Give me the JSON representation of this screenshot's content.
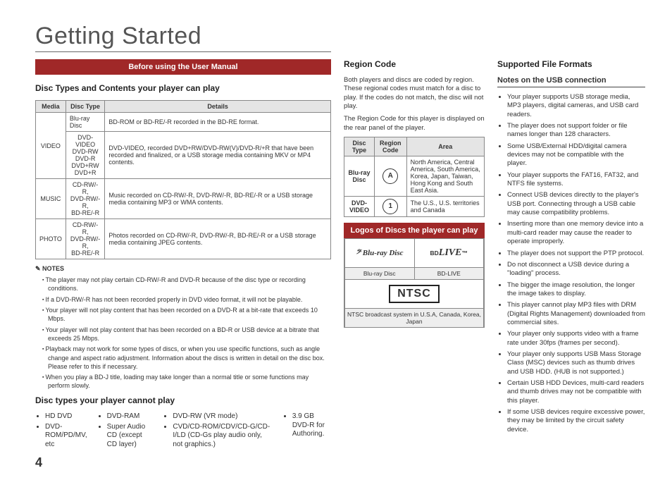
{
  "pageTitle": "Getting Started",
  "pageNumber": "4",
  "banner": "Before using the User Manual",
  "discTypesHead": "Disc Types and Contents your player can play",
  "playTable": {
    "headers": [
      "Media",
      "Disc Type",
      "Details"
    ],
    "rows": [
      {
        "media": "VIDEO",
        "type": "Blu-ray Disc",
        "details": "BD-ROM or BD-RE/-R recorded in the BD-RE format.",
        "rowspan": 1
      },
      {
        "media": "",
        "type": "DVD-VIDEO\nDVD-RW\nDVD-R\nDVD+RW\nDVD+R",
        "details": "DVD-VIDEO, recorded DVD+RW/DVD-RW(V)/DVD-R/+R that have been recorded and finalized, or a USB storage media containing MKV or MP4 contents."
      },
      {
        "media": "MUSIC",
        "type": "CD-RW/-R,\nDVD-RW/-R,\nBD-RE/-R",
        "details": "Music recorded on CD-RW/-R, DVD-RW/-R, BD-RE/-R or a USB storage media containing MP3 or WMA contents."
      },
      {
        "media": "PHOTO",
        "type": "CD-RW/-R,\nDVD-RW/-R,\nBD-RE/-R",
        "details": "Photos recorded on CD-RW/-R, DVD-RW/-R, BD-RE/-R or a USB storage media containing JPEG contents."
      }
    ]
  },
  "notesLabel": "NOTES",
  "notes": [
    "The player may not play certain CD-RW/-R and DVD-R because of the disc type or recording conditions.",
    "If a DVD-RW/-R has not been recorded properly in DVD video format, it will not be playable.",
    "Your player will not play content that has been recorded on a DVD-R at a bit-rate that exceeds 10 Mbps.",
    "Your player will not play content that has been recorded on a BD-R or USB device at a bitrate that exceeds 25 Mbps.",
    "Playback may not work for some types of discs, or when you use specific functions, such as angle change and aspect ratio adjustment. Information about the discs is written in detail on the disc box. Please refer to this if necessary.",
    "When you play a BD-J title, loading may take longer than a normal title or some functions may perform slowly."
  ],
  "cannotHead": "Disc types your player cannot play",
  "cannotCols": [
    [
      "HD DVD",
      "DVD-ROM/PD/MV, etc"
    ],
    [
      "DVD-RAM",
      "Super Audio CD (except CD layer)"
    ],
    [
      "DVD-RW (VR mode)",
      "CVD/CD-ROM/CDV/CD-G/CD-I/LD (CD-Gs play audio only, not graphics.)"
    ],
    [
      "3.9 GB DVD-R for Authoring."
    ]
  ],
  "regionHead": "Region Code",
  "regionPara1": "Both players and discs are coded by region. These regional codes must match for a disc to play. If the codes do not match, the disc will not play.",
  "regionPara2": "The Region Code for this player is displayed on the rear panel of the player.",
  "regionTable": {
    "headers": [
      "Disc Type",
      "Region Code",
      "Area"
    ],
    "rows": [
      {
        "type": "Blu-ray Disc",
        "code": "A",
        "area": "North America, Central America, South America, Korea, Japan, Taiwan, Hong Kong and South East Asia."
      },
      {
        "type": "DVD-VIDEO",
        "code": "1",
        "area": "The U.S., U.S. territories and Canada"
      }
    ]
  },
  "logosBanner": "Logos of Discs the player can play",
  "logos": {
    "r1c1": "Blu-ray Disc",
    "r1c2": "BD-LIVE",
    "ntsc": "NTSC",
    "ntscCaption": "NTSC broadcast system in U.S.A, Canada, Korea, Japan"
  },
  "formatsHead": "Supported File Formats",
  "usbSubhead": "Notes on the USB connection",
  "usbNotes": [
    "Your player supports USB storage media, MP3 players, digital cameras, and USB card readers.",
    "The player does not support folder or file names longer than 128 characters.",
    "Some USB/External HDD/digital camera devices may not be compatible with the player.",
    "Your player supports the FAT16, FAT32, and NTFS file systems.",
    "Connect USB devices directly to the player's USB port. Connecting through a USB cable may cause compatibility problems.",
    "Inserting more than one memory device into a multi-card reader may cause the reader to operate improperly.",
    "The player does not support the PTP protocol.",
    "Do not disconnect a USB device during a \"loading\" process.",
    "The bigger the image resolution, the longer the image takes to display.",
    "This player cannot play MP3 files with DRM (Digital Rights Management) downloaded from commercial sites.",
    "Your player only supports video with a frame rate under 30fps (frames per second).",
    "Your player only supports USB Mass Storage Class (MSC) devices such as thumb drives and USB HDD. (HUB is not supported.)",
    "Certain USB HDD Devices, multi-card readers and thumb drives may not be compatible with this player.",
    "If some USB devices require excessive power, they may be limited by the circuit safety device."
  ]
}
